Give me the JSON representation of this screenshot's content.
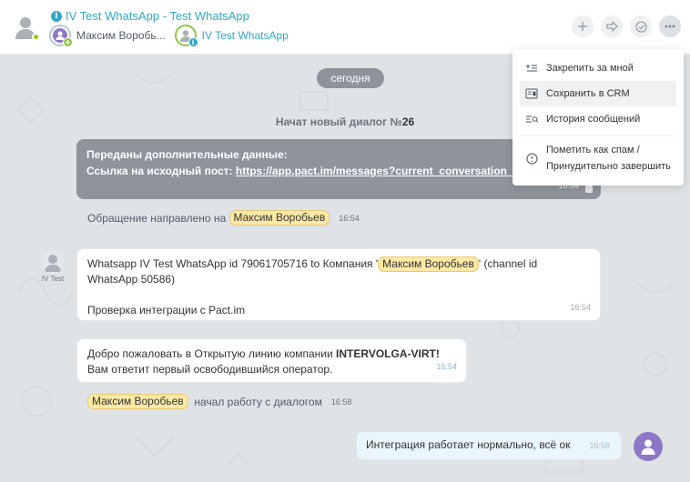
{
  "header": {
    "title": "IV Test WhatsApp - Test WhatsApp",
    "operator_name": "Максим Воробь...",
    "line_name": "IV Test WhatsApp"
  },
  "chat": {
    "date_label": "сегодня",
    "start_prefix": "Начат новый диалог №",
    "start_number": "26",
    "grey_card": {
      "title": "Переданы дополнительные данные:",
      "link_label": "Ссылка на исходный пост:",
      "link_url": "https://app.pact.im/messages?current_conversation_id=",
      "time": "16:54"
    },
    "routed": {
      "text": "Обращение направлено на",
      "operator": "Максим Воробьев",
      "time": "16:54"
    },
    "bot": {
      "avatar_label": "IV Test",
      "line1_prefix": "Whatsapp IV Test WhatsApp id 79061705716 to Компания '",
      "line1_tag": "Максим Воробьев",
      "line1_suffix": "' (channel id",
      "line2": "WhatsApp 50586)",
      "line3": "Проверка интеграции с Pact.im",
      "time": "16:54"
    },
    "welcome": {
      "line1_prefix": "Добро пожаловать в Открытую линию компании ",
      "line1_bold": "INTERVOLGA-VIRT!",
      "line2": "Вам ответит первый освободившийся оператор.",
      "time": "16:54"
    },
    "started": {
      "operator": "Максим Воробьев",
      "text": "начал работу с диалогом",
      "time": "16:58"
    },
    "outgoing": {
      "text": "Интеграция работает нормально, всё ок",
      "time": "16:58"
    }
  },
  "menu": {
    "items": [
      {
        "icon": "pin-icon",
        "label": "Закрепить за мной"
      },
      {
        "icon": "crm-save-icon",
        "label": "Сохранить в CRM"
      },
      {
        "icon": "history-icon",
        "label": "История сообщений"
      }
    ],
    "spam_line1": "Пометить как спам /",
    "spam_line2": "Принудительно завершить"
  },
  "colors": {
    "accent": "#2fa8c7",
    "online": "#9dcf00",
    "tag_bg": "#fde9a4",
    "operator_avatar": "#8d77c6"
  }
}
